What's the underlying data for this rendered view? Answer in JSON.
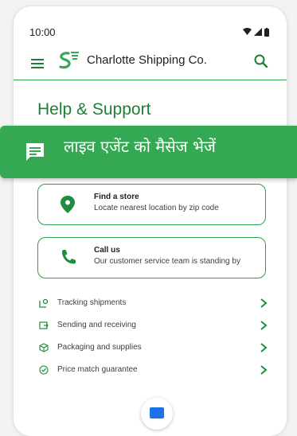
{
  "status_bar": {
    "time": "10:00",
    "icons": [
      "wifi-icon",
      "signal-icon",
      "battery-icon"
    ]
  },
  "app_bar": {
    "brand_name": "Charlotte Shipping Co.",
    "menu_icon": "menu-icon",
    "search_icon": "search-icon",
    "logo_icon": "logo-icon"
  },
  "page": {
    "title": "Help & Support"
  },
  "banner": {
    "text": "लाइव एजेंट को मैसेज भेजें",
    "icon": "chat-icon",
    "color": "#34a853"
  },
  "cards": [
    {
      "title": "Find a store",
      "subtitle": "Locate nearest location by zip code",
      "icon": "location-pin-icon"
    },
    {
      "title": "Call us",
      "subtitle": "Our customer service team is standing by",
      "icon": "phone-icon"
    }
  ],
  "help_topics": [
    {
      "label": "Tracking shipments",
      "icon": "tracking-icon"
    },
    {
      "label": "Sending and receiving",
      "icon": "send-icon"
    },
    {
      "label": "Packaging and supplies",
      "icon": "package-icon"
    },
    {
      "label": "Price match guarantee",
      "icon": "guarantee-icon"
    }
  ],
  "theme": {
    "accent": "#1e7e34",
    "accent_light": "#34a853",
    "fab_color": "#1a73e8"
  }
}
